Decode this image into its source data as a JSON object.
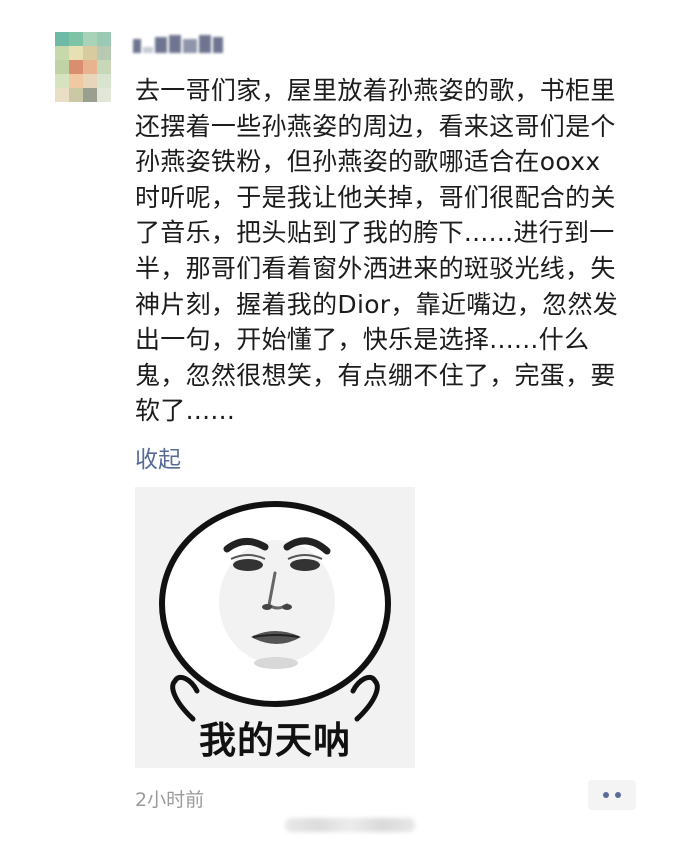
{
  "post": {
    "text_lines": [
      "去一哥们家，屋里放着孙燕姿的歌，书柜里",
      "还摆着一些孙燕姿的周边，看来这哥们是个",
      "孙燕姿铁粉，但孙燕姿的歌哪适合在ooxx",
      "时听呢，于是我让他关掉，哥们很配合的关",
      "了音乐，把头贴到了我的胯下......进行到一",
      "半，那哥们看着窗外洒进来的斑驳光线，失",
      "神片刻，握着我的Dior，靠近嘴边，忽然发",
      "出一句，开始懂了，快乐是选择......什么",
      "鬼，忽然很想笑，有点绷不住了，完蛋，要",
      "软了......"
    ],
    "collapse_label": "收起",
    "meme_caption": "我的天呐",
    "timestamp": "2小时前"
  },
  "colors": {
    "link": "#576b95",
    "timestamp": "#9b9b9b",
    "more_dots": "#5a6c98"
  },
  "icons": {
    "more": "more-dots-icon"
  }
}
